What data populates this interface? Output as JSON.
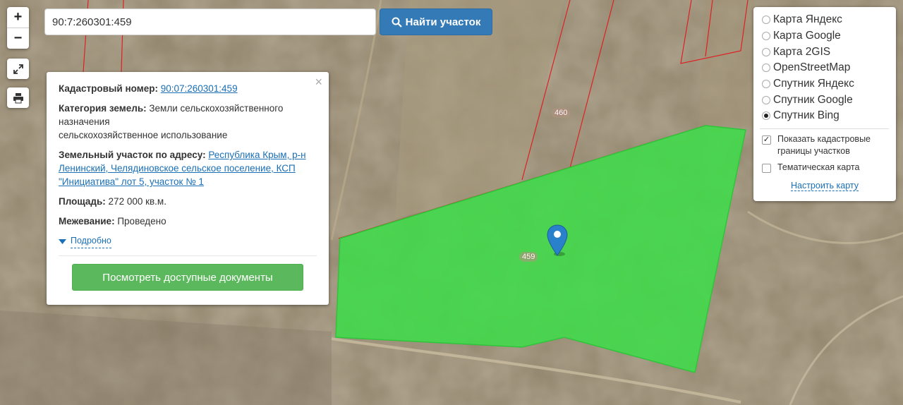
{
  "search": {
    "value": "90:7:260301:459",
    "button_label": "Найти участок",
    "button_icon": "search-icon"
  },
  "map_controls": {
    "zoom_in": "+",
    "zoom_out": "−",
    "fullscreen_icon": "expand-icon",
    "print_icon": "printer-icon"
  },
  "parcel_labels": {
    "main": "459",
    "neighbor": "460"
  },
  "popup": {
    "close": "×",
    "cadastral_label": "Кадастровый номер:",
    "cadastral_value": "90:07:260301:459",
    "category_label": "Категория земель:",
    "category_value": "Земли сельскохозяйственного назначения",
    "category_use": "сельскохозяйственное использование",
    "address_label": "Земельный участок по адресу:",
    "address_value": "Республика Крым, р-н Ленинский, Челядиновское сельское поселение, КСП \"Инициатива\" лот 5, участок № 1",
    "area_label": "Площадь:",
    "area_value": "272 000 кв.м.",
    "survey_label": "Межевание:",
    "survey_value": "Проведено",
    "more_label": "Подробно",
    "docs_button": "Посмотреть доступные документы"
  },
  "layers": {
    "options": [
      {
        "label": "Карта Яндекс",
        "selected": false
      },
      {
        "label": "Карта Google",
        "selected": false
      },
      {
        "label": "Карта 2GIS",
        "selected": false
      },
      {
        "label": "OpenStreetMap",
        "selected": false
      },
      {
        "label": "Спутник Яндекс",
        "selected": false
      },
      {
        "label": "Спутник Google",
        "selected": false
      },
      {
        "label": "Спутник Bing",
        "selected": true
      }
    ],
    "show_borders": {
      "label": "Показать кадастровые границы участков",
      "checked": true
    },
    "thematic": {
      "label": "Тематическая карта",
      "checked": false
    },
    "configure_link": "Настроить карту"
  },
  "colors": {
    "parcel_fill": "#3fdc4a",
    "parcel_border": "#d22",
    "primary": "#337ab7",
    "success": "#5cb85c",
    "link": "#1a6fb5"
  }
}
